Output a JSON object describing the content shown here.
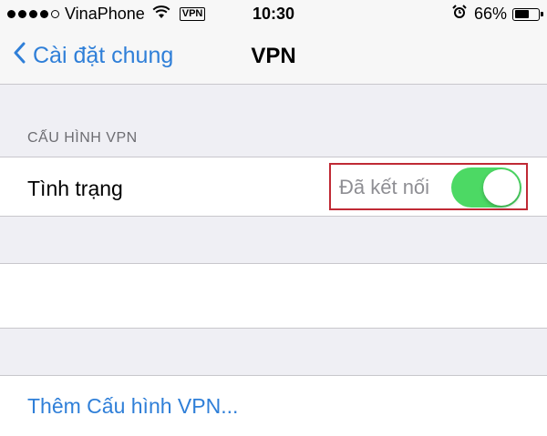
{
  "status_bar": {
    "carrier": "VinaPhone",
    "vpn_badge": "VPN",
    "time": "10:30",
    "battery_percent": "66%",
    "battery_level": 0.66,
    "signal_bars_filled": 4,
    "signal_bars_total": 5,
    "icons": [
      "wifi-icon",
      "alarm-icon",
      "battery-icon"
    ]
  },
  "nav": {
    "back_label": "Cài đặt chung",
    "title": "VPN"
  },
  "section": {
    "header": "CẤU HÌNH VPN"
  },
  "status_row": {
    "label": "Tình trạng",
    "value": "Đã kết nối",
    "toggle_on": true
  },
  "add_row": {
    "label": "Thêm Cấu hình VPN..."
  },
  "colors": {
    "accent": "#2f7fd8",
    "toggle_on": "#4cd964",
    "highlight_border": "#c02a35",
    "background": "#efeff4"
  }
}
